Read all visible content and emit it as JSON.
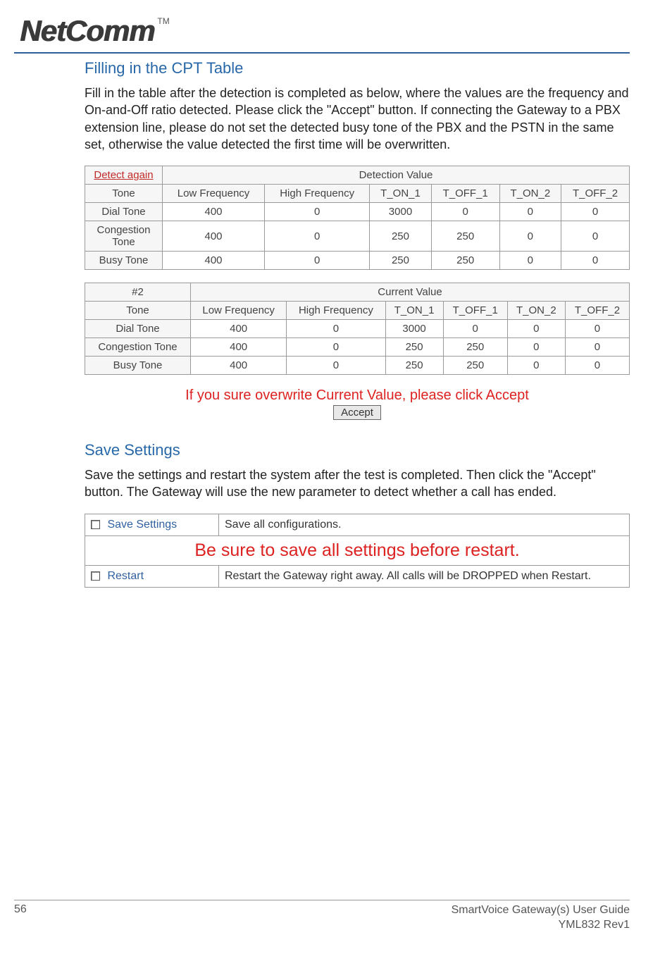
{
  "logo": {
    "text": "NetComm",
    "tm": "TM"
  },
  "section1": {
    "heading": "Filling in the CPT Table",
    "paragraph": "Fill in the table after the detection is completed as below, where the values are the frequency and On-and-Off ratio detected. Please click the \"Accept\" button. If connecting the Gateway to a PBX extension line, please do not set the detected busy tone of the PBX and the PSTN in the same set, otherwise the value detected the first time will be overwritten."
  },
  "table1": {
    "detect_again": "Detect again",
    "detection_value": "Detection Value",
    "headers": {
      "tone": "Tone",
      "lf": "Low Frequency",
      "hf": "High Frequency",
      "t_on_1": "T_ON_1",
      "t_off_1": "T_OFF_1",
      "t_on_2": "T_ON_2",
      "t_off_2": "T_OFF_2"
    },
    "rows": [
      {
        "tone": "Dial Tone",
        "lf": "400",
        "hf": "0",
        "t_on_1": "3000",
        "t_off_1": "0",
        "t_on_2": "0",
        "t_off_2": "0"
      },
      {
        "tone": "Congestion Tone",
        "lf": "400",
        "hf": "0",
        "t_on_1": "250",
        "t_off_1": "250",
        "t_on_2": "0",
        "t_off_2": "0"
      },
      {
        "tone": "Busy Tone",
        "lf": "400",
        "hf": "0",
        "t_on_1": "250",
        "t_off_1": "250",
        "t_on_2": "0",
        "t_off_2": "0"
      }
    ]
  },
  "table2": {
    "index": "#2",
    "current_value": "Current Value",
    "headers": {
      "tone": "Tone",
      "lf": "Low Frequency",
      "hf": "High Frequency",
      "t_on_1": "T_ON_1",
      "t_off_1": "T_OFF_1",
      "t_on_2": "T_ON_2",
      "t_off_2": "T_OFF_2"
    },
    "rows": [
      {
        "tone": "Dial Tone",
        "lf": "400",
        "hf": "0",
        "t_on_1": "3000",
        "t_off_1": "0",
        "t_on_2": "0",
        "t_off_2": "0"
      },
      {
        "tone": "Congestion Tone",
        "lf": "400",
        "hf": "0",
        "t_on_1": "250",
        "t_off_1": "250",
        "t_on_2": "0",
        "t_off_2": "0"
      },
      {
        "tone": "Busy Tone",
        "lf": "400",
        "hf": "0",
        "t_on_1": "250",
        "t_off_1": "250",
        "t_on_2": "0",
        "t_off_2": "0"
      }
    ]
  },
  "overwrite_prompt": "If you sure overwrite Current Value, please click Accept",
  "accept_label": "Accept",
  "section2": {
    "heading": "Save Settings",
    "paragraph": "Save the settings and restart the system after the test is completed. Then click the \"Accept\" button. The Gateway will use the new parameter to detect whether a call has ended."
  },
  "save_table": {
    "save_label": "Save Settings",
    "save_desc": "Save all configurations.",
    "banner": "Be sure to save all settings before restart.",
    "restart_label": "Restart",
    "restart_desc": "Restart the Gateway right away. All calls will be DROPPED when Restart."
  },
  "footer": {
    "page": "56",
    "guide": "SmartVoice Gateway(s) User Guide",
    "rev": "YML832 Rev1"
  }
}
